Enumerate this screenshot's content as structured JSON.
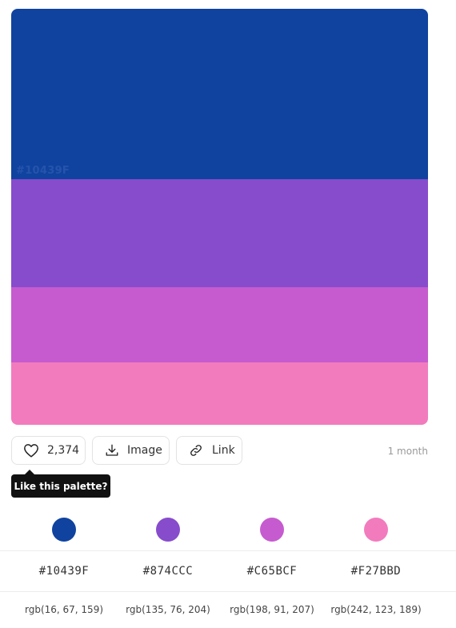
{
  "palette": {
    "swatches": [
      {
        "hex": "#10439F",
        "label": "#10439F"
      },
      {
        "hex": "#874CCC",
        "label": ""
      },
      {
        "hex": "#C65BCF",
        "label": ""
      },
      {
        "hex": "#F27BBD",
        "label": ""
      }
    ]
  },
  "actions": {
    "like_count": "2,374",
    "image_label": "Image",
    "link_label": "Link",
    "time_ago": "1 month",
    "tooltip": "Like this palette?"
  },
  "colors": [
    {
      "hex": "#10439F",
      "hex_text": "#10439F",
      "rgb_text": "rgb(16, 67, 159)"
    },
    {
      "hex": "#874CCC",
      "hex_text": "#874CCC",
      "rgb_text": "rgb(135, 76, 204)"
    },
    {
      "hex": "#C65BCF",
      "hex_text": "#C65BCF",
      "rgb_text": "rgb(198, 91, 207)"
    },
    {
      "hex": "#F27BBD",
      "hex_text": "#F27BBD",
      "rgb_text": "rgb(242, 123, 189)"
    }
  ],
  "icons": {
    "like": "heart-icon",
    "image": "download-icon",
    "link": "link-icon"
  }
}
